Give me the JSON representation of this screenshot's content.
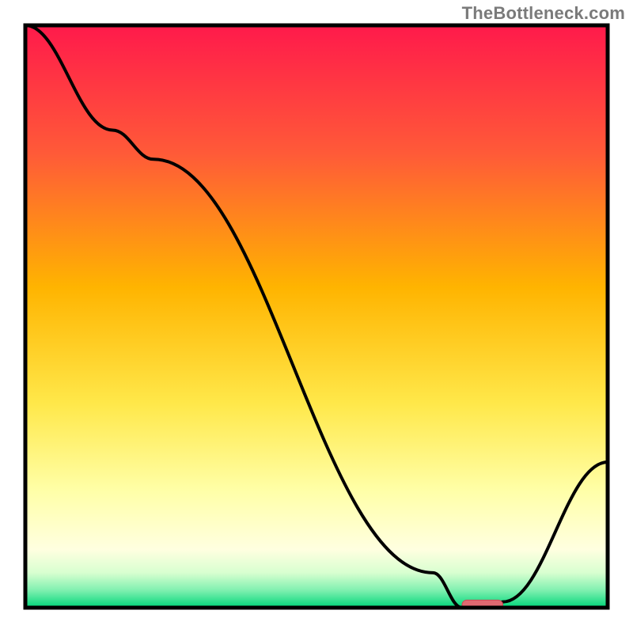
{
  "watermark": "TheBottleneck.com",
  "colors": {
    "frame": "#000000",
    "gradient_top": "#ff1a4b",
    "gradient_upper": "#ff6a2a",
    "gradient_mid": "#ffb800",
    "gradient_lower": "#ffe84a",
    "gradient_pale": "#ffffb0",
    "gradient_mint": "#9ff0c0",
    "gradient_green": "#00d67a",
    "curve": "#000000",
    "marker_fill": "#e06a72",
    "marker_stroke": "#cc4a55"
  },
  "chart_data": {
    "type": "line",
    "title": "",
    "xlabel": "",
    "ylabel": "",
    "xlim": [
      0,
      100
    ],
    "ylim": [
      0,
      100
    ],
    "series": [
      {
        "name": "bottleneck-curve",
        "x": [
          0,
          15,
          22,
          70,
          75,
          80,
          82,
          100
        ],
        "values": [
          100,
          82,
          77,
          6,
          0,
          0,
          1,
          25
        ]
      }
    ],
    "annotations": [
      {
        "name": "optimal-marker",
        "shape": "capsule",
        "x_range": [
          75,
          82
        ],
        "y": 0.5
      }
    ]
  }
}
